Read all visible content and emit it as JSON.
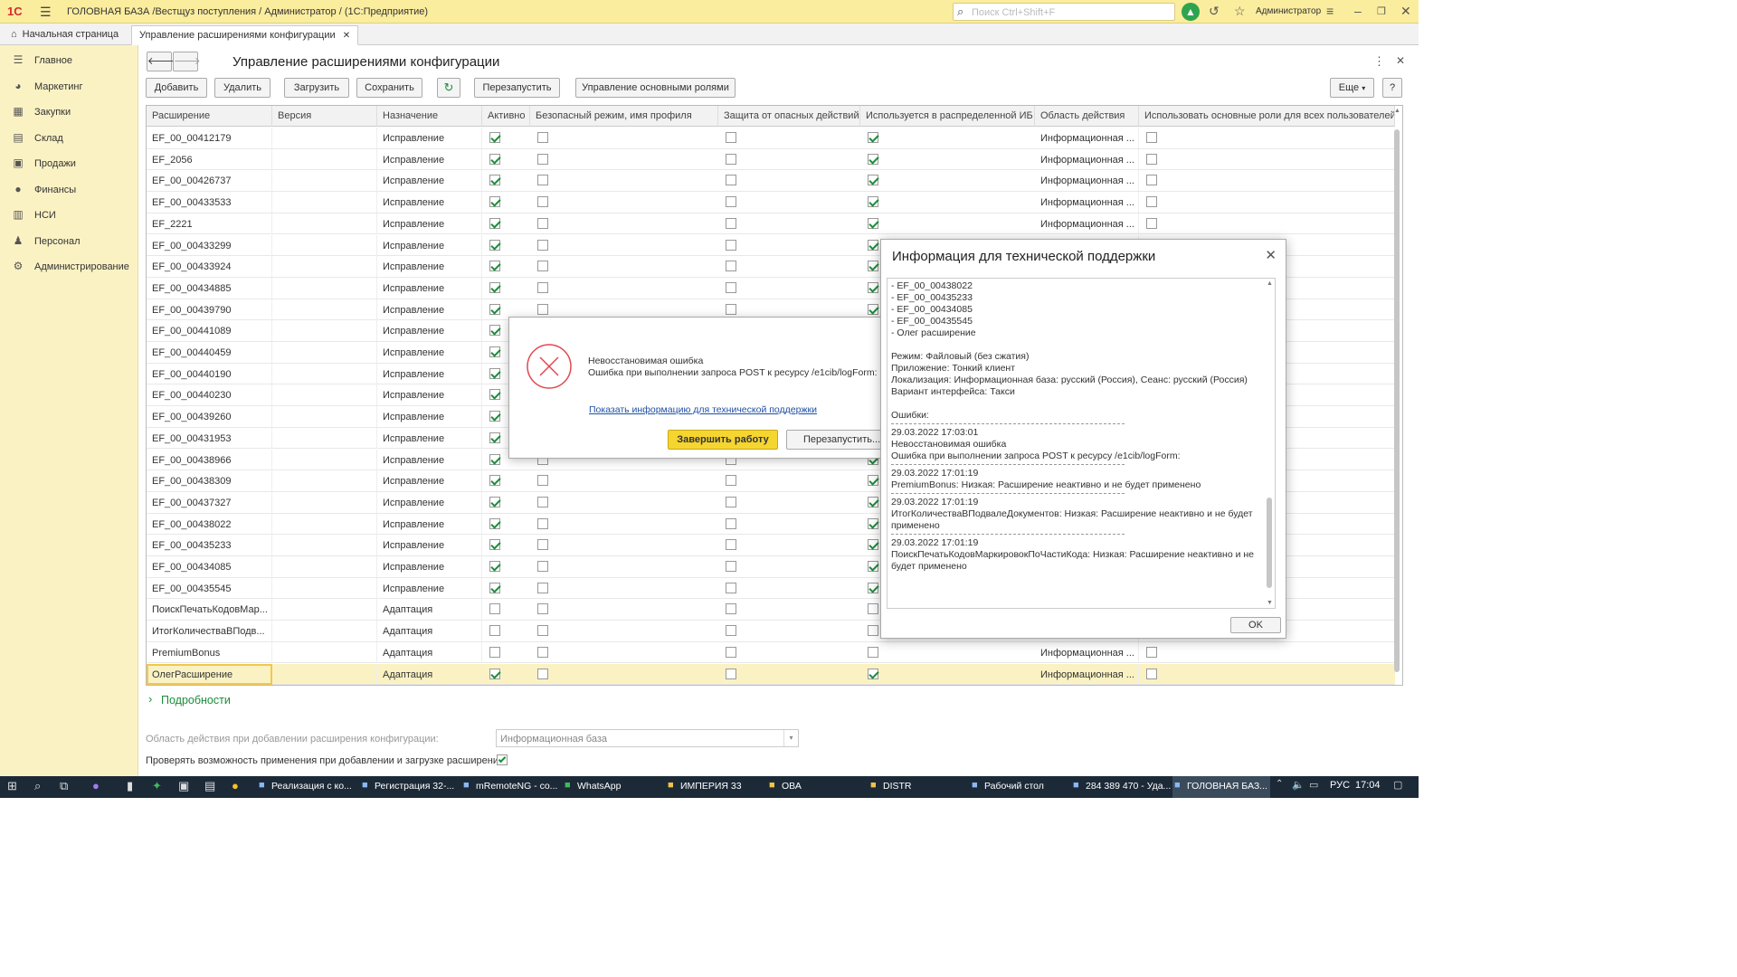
{
  "window": {
    "logo": "1С",
    "title": "ГОЛОВНАЯ БАЗА /Вестщуз поступления / Администратор /  (1С:Предприятие)",
    "search_placeholder": "Поиск Ctrl+Shift+F",
    "user": "Администратор"
  },
  "tabs": {
    "home": "Начальная страница",
    "active": "Управление расширениями конфигурации"
  },
  "sidebar": {
    "items": [
      {
        "label": "Главное",
        "icon": "menu-icon"
      },
      {
        "label": "Маркетинг",
        "icon": "marketing-icon"
      },
      {
        "label": "Закупки",
        "icon": "purchases-icon"
      },
      {
        "label": "Склад",
        "icon": "warehouse-icon"
      },
      {
        "label": "Продажи",
        "icon": "sales-icon"
      },
      {
        "label": "Финансы",
        "icon": "finance-icon"
      },
      {
        "label": "НСИ",
        "icon": "reference-icon"
      },
      {
        "label": "Персонал",
        "icon": "person-icon"
      },
      {
        "label": "Администрирование",
        "icon": "gear-icon"
      }
    ]
  },
  "form": {
    "title": "Управление расширениями конфигурации",
    "buttons": {
      "add": "Добавить",
      "delete": "Удалить",
      "load": "Загрузить",
      "save": "Сохранить",
      "restart": "Перезапустить",
      "roles": "Управление основными ролями",
      "more": "Еще",
      "help": "?"
    },
    "columns": [
      "Расширение",
      "Версия",
      "Назначение",
      "Активно",
      "Безопасный режим, имя профиля",
      "Защита от опасных действий",
      "Используется в распределенной ИБ",
      "Область действия",
      "Использовать основные роли для всех пользователей"
    ],
    "rows": [
      {
        "name": "EF_00_00412179",
        "purpose": "Исправление",
        "active": true,
        "safe": false,
        "protect": false,
        "distributed": true,
        "scope": "Информационная ...",
        "roles": false
      },
      {
        "name": "EF_2056",
        "purpose": "Исправление",
        "active": true,
        "safe": false,
        "protect": false,
        "distributed": true,
        "scope": "Информационная ...",
        "roles": false
      },
      {
        "name": "EF_00_00426737",
        "purpose": "Исправление",
        "active": true,
        "safe": false,
        "protect": false,
        "distributed": true,
        "scope": "Информационная ...",
        "roles": false
      },
      {
        "name": "EF_00_00433533",
        "purpose": "Исправление",
        "active": true,
        "safe": false,
        "protect": false,
        "distributed": true,
        "scope": "Информационная ...",
        "roles": false
      },
      {
        "name": "EF_2221",
        "purpose": "Исправление",
        "active": true,
        "safe": false,
        "protect": false,
        "distributed": true,
        "scope": "Информационная ...",
        "roles": false
      },
      {
        "name": "EF_00_00433299",
        "purpose": "Исправление",
        "active": true,
        "safe": false,
        "protect": false,
        "distributed": true,
        "scope": "",
        "roles": false
      },
      {
        "name": "EF_00_00433924",
        "purpose": "Исправление",
        "active": true,
        "safe": false,
        "protect": false,
        "distributed": true,
        "scope": "",
        "roles": false
      },
      {
        "name": "EF_00_00434885",
        "purpose": "Исправление",
        "active": true,
        "safe": false,
        "protect": false,
        "distributed": true,
        "scope": "",
        "roles": false
      },
      {
        "name": "EF_00_00439790",
        "purpose": "Исправление",
        "active": true,
        "safe": false,
        "protect": false,
        "distributed": true,
        "scope": "",
        "roles": false
      },
      {
        "name": "EF_00_00441089",
        "purpose": "Исправление",
        "active": true,
        "safe": false,
        "protect": false,
        "distributed": true,
        "scope": "",
        "roles": false
      },
      {
        "name": "EF_00_00440459",
        "purpose": "Исправление",
        "active": true,
        "safe": false,
        "protect": false,
        "distributed": true,
        "scope": "",
        "roles": false
      },
      {
        "name": "EF_00_00440190",
        "purpose": "Исправление",
        "active": true,
        "safe": false,
        "protect": false,
        "distributed": true,
        "scope": "",
        "roles": false
      },
      {
        "name": "EF_00_00440230",
        "purpose": "Исправление",
        "active": true,
        "safe": false,
        "protect": false,
        "distributed": true,
        "scope": "",
        "roles": false
      },
      {
        "name": "EF_00_00439260",
        "purpose": "Исправление",
        "active": true,
        "safe": false,
        "protect": false,
        "distributed": true,
        "scope": "",
        "roles": false
      },
      {
        "name": "EF_00_00431953",
        "purpose": "Исправление",
        "active": true,
        "safe": false,
        "protect": false,
        "distributed": true,
        "scope": "",
        "roles": false
      },
      {
        "name": "EF_00_00438966",
        "purpose": "Исправление",
        "active": true,
        "safe": false,
        "protect": false,
        "distributed": true,
        "scope": "",
        "roles": false
      },
      {
        "name": "EF_00_00438309",
        "purpose": "Исправление",
        "active": true,
        "safe": false,
        "protect": false,
        "distributed": true,
        "scope": "",
        "roles": false
      },
      {
        "name": "EF_00_00437327",
        "purpose": "Исправление",
        "active": true,
        "safe": false,
        "protect": false,
        "distributed": true,
        "scope": "",
        "roles": false
      },
      {
        "name": "EF_00_00438022",
        "purpose": "Исправление",
        "active": true,
        "safe": false,
        "protect": false,
        "distributed": true,
        "scope": "",
        "roles": false
      },
      {
        "name": "EF_00_00435233",
        "purpose": "Исправление",
        "active": true,
        "safe": false,
        "protect": false,
        "distributed": true,
        "scope": "",
        "roles": false
      },
      {
        "name": "EF_00_00434085",
        "purpose": "Исправление",
        "active": true,
        "safe": false,
        "protect": false,
        "distributed": true,
        "scope": "",
        "roles": false
      },
      {
        "name": "EF_00_00435545",
        "purpose": "Исправление",
        "active": true,
        "safe": false,
        "protect": false,
        "distributed": true,
        "scope": "",
        "roles": false
      },
      {
        "name": "ПоискПечатьКодовМар...",
        "purpose": "Адаптация",
        "active": false,
        "safe": false,
        "protect": false,
        "distributed": false,
        "scope": "",
        "roles": false
      },
      {
        "name": "ИтогКоличестваВПодв...",
        "purpose": "Адаптация",
        "active": false,
        "safe": false,
        "protect": false,
        "distributed": false,
        "scope": "",
        "roles": false
      },
      {
        "name": "PremiumBonus",
        "purpose": "Адаптация",
        "active": false,
        "safe": false,
        "protect": false,
        "distributed": false,
        "scope": "Информационная ...",
        "roles": false
      },
      {
        "name": "ОлегРасширение",
        "purpose": "Адаптация",
        "active": true,
        "safe": false,
        "protect": false,
        "distributed": true,
        "scope": "Информационная ...",
        "roles": false
      }
    ],
    "details": "Подробности",
    "scope_label": "Область действия при добавлении расширения конфигурации:",
    "scope_value": "Информационная база",
    "check_label": "Проверять возможность применения при добавлении и загрузке расширений:"
  },
  "error_dialog": {
    "title": "Невосстановимая ошибка",
    "message": "Ошибка при выполнении запроса POST к ресурсу /e1cib/logForm:",
    "link": "Показать информацию для технической поддержки",
    "finish": "Завершить работу",
    "restart": "Перезапустить..."
  },
  "info_dialog": {
    "title": "Информация для технической поддержки",
    "ok": "OK",
    "lines": [
      "- EF_00_00438022",
      "- EF_00_00435233",
      "- EF_00_00434085",
      "- EF_00_00435545",
      "- Олег расширение",
      "",
      "Режим: Файловый (без сжатия)",
      "Приложение: Тонкий клиент",
      "Локализация: Информационная база: русский (Россия), Сеанс: русский (Россия)",
      "Вариант интерфейса: Такси",
      "",
      "Ошибки:",
      "---",
      "29.03.2022 17:03:01",
      "Невосстановимая ошибка",
      "Ошибка при выполнении запроса POST к ресурсу /e1cib/logForm:",
      "---",
      "29.03.2022 17:01:19",
      "PremiumBonus: Низкая: Расширение неактивно и не будет применено",
      "---",
      "29.03.2022 17:01:19",
      "ИтогКоличестваВПодвалеДокументов: Низкая: Расширение неактивно и не будет",
      "применено",
      "---",
      "29.03.2022 17:01:19",
      "ПоискПечатьКодовМаркировокПоЧастиКода: Низкая: Расширение неактивно и не",
      "будет применено"
    ]
  },
  "taskbar": {
    "items": [
      "Реализация с ко...",
      "Регистрация 32-...",
      "mRemoteNG - co...",
      "WhatsApp",
      "ИМПЕРИЯ 33",
      "ОВА",
      "DISTR",
      "Рабочий стол",
      "284 389 470 - Уда...",
      "ГОЛОВНАЯ БАЗ..."
    ],
    "lang": "РУС",
    "time": "17:04"
  }
}
